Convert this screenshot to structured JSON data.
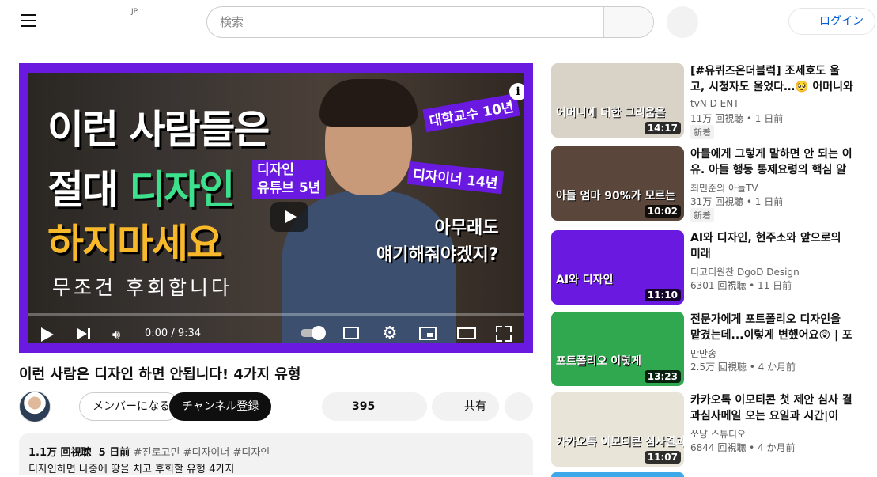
{
  "header": {
    "region": "JP",
    "search_placeholder": "検索",
    "login_label": "ログイン"
  },
  "player": {
    "thumb_line1": "이런 사람들은",
    "thumb_line2a": "절대 ",
    "thumb_line2b": "디자인",
    "thumb_line3": "하지마세요",
    "thumb_line4": "무조건 후회합니다",
    "tag1": "대학교수 10년",
    "tag2_line1": "디자인",
    "tag2_line2": "유튜브 5년",
    "tag3": "디자이너 14년",
    "quote_line1": "아무래도",
    "quote_line2": "얘기해줘야겠지?",
    "time": "0:00 / 9:34",
    "progress": 0
  },
  "video": {
    "title": "이런 사람은 디자인 하면 안됩니다! 4가지 유형",
    "member_label": "メンバーになる",
    "subscribe_label": "チャンネル登録",
    "like_count": "395",
    "share_label": "共有",
    "views": "1.1万 回視聴",
    "date": "5 日前",
    "tags": "#진로고민 #디자이너 #디자인",
    "description": "디자인하면 나중에 땅을 치고 후회할 유형 4가지"
  },
  "recommendations": [
    {
      "title": "[#유퀴즈온더블럭] 조세호도 울고, 시청자도 울었다…🥺 어머니와 이별…",
      "channel": "tvN D ENT",
      "meta": "11万 回視聴 • 1 日前",
      "badge": "新着",
      "duration": "14:17",
      "thumb_text": "어머니에 대한 그리움을",
      "bg": "#d9d2c6"
    },
    {
      "title": "아들에게 그렇게 말하면 안 되는 이유. 아들 행동 통제요령의 핵심 알려…",
      "channel": "최민준의 아들TV",
      "meta": "31万 回視聴 • 1 日前",
      "badge": "新着",
      "duration": "10:02",
      "thumb_text": "아들 엄마 90%가 모르는",
      "bg": "#5a463a"
    },
    {
      "title": "AI와 디자인, 현주소와 앞으로의 미래",
      "channel": "디고디원찬 DgoD Design",
      "meta": "6301 回視聴 • 11 日前",
      "badge": "",
      "duration": "11:10",
      "thumb_text": "AI와 디자인",
      "bg": "#6a1ae0"
    },
    {
      "title": "전문가에게 포트폴리오 디자인을 맡겼는데...이렇게 변했어요😲 | 포폴…",
      "channel": "만만송",
      "meta": "2.5万 回視聴 • 4 か月前",
      "badge": "",
      "duration": "13:23",
      "thumb_text": "포트폴리오 이렇게",
      "bg": "#2fa84f"
    },
    {
      "title": "카카오톡 이모티콘 첫 제안 심사 결과심사메일 오는 요일과 시간|이모…",
      "channel": "쏘냥 스튜디오",
      "meta": "6844 回視聴 • 4 か月前",
      "badge": "",
      "duration": "11:07",
      "thumb_text": "카카오톡 이모티콘 심사결과",
      "bg": "#e8e4d8"
    }
  ],
  "colors": {
    "accent_purple": "#6a1ae0",
    "thumb_green": "#3de08c",
    "thumb_yellow": "#f7b82a",
    "link_blue": "#065fd4"
  }
}
